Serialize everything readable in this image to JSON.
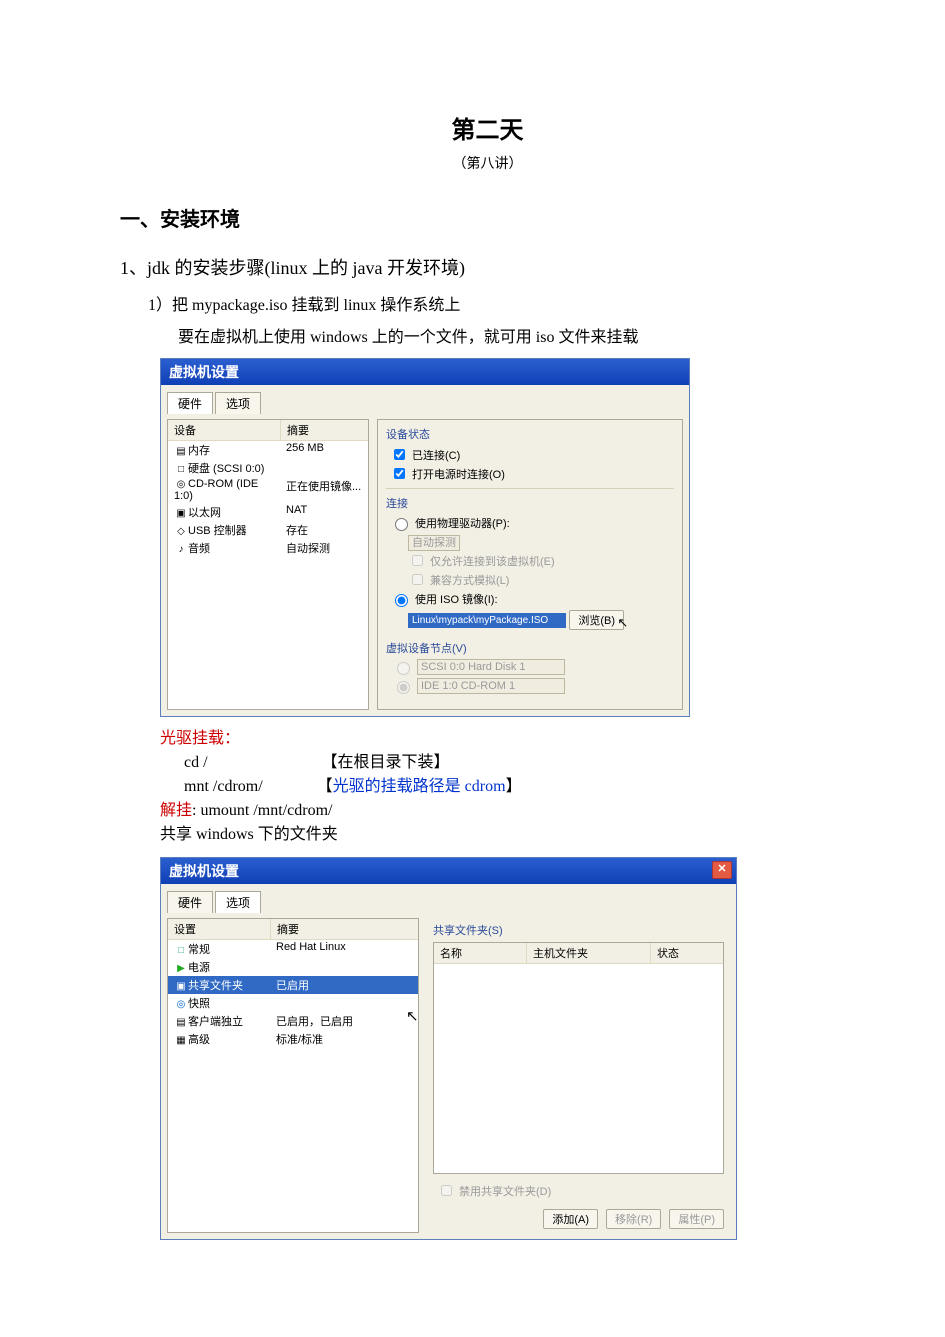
{
  "doc": {
    "title": "第二天",
    "subtitle": "（第八讲）",
    "h1": "一、安装环境",
    "h2": "1、jdk 的安装步骤(linux 上的 java  开发环境)",
    "step1_line1": "1）把 mypackage.iso  挂载到 linux 操作系统上",
    "step1_line2": "要在虚拟机上使用 windows 上的一个文件，就可用 iso 文件来挂载"
  },
  "vm1": {
    "title": "虚拟机设置",
    "tab_hardware": "硬件",
    "tab_options": "选项",
    "col_device": "设备",
    "col_summary": "摘要",
    "rows": [
      {
        "icon": "▤",
        "name": "内存",
        "summary": "256 MB"
      },
      {
        "icon": "□",
        "name": "硬盘 (SCSI 0:0)",
        "summary": ""
      },
      {
        "icon": "◎",
        "name": "CD-ROM (IDE 1:0)",
        "summary": "正在使用镜像..."
      },
      {
        "icon": "▣",
        "name": "以太网",
        "summary": "NAT"
      },
      {
        "icon": "◇",
        "name": "USB 控制器",
        "summary": "存在"
      },
      {
        "icon": "♪",
        "name": "音频",
        "summary": "自动探测"
      }
    ],
    "grp_status": "设备状态",
    "chk_connected": "已连接(C)",
    "chk_poweron": "打开电源时连接(O)",
    "grp_conn": "连接",
    "radio_phys": "使用物理驱动器(P):",
    "dd_auto": "自动探测",
    "chk_passthrough": "仅允许连接到该虚拟机(E)",
    "chk_legacy": "兼容方式模拟(L)",
    "radio_iso": "使用 ISO 镜像(I):",
    "iso_path": "Linux\\mypack\\myPackage.ISO",
    "btn_browse": "浏览(B)",
    "grp_node": "虚拟设备节点(V)",
    "dd_scsi": "SCSI 0:0   Hard Disk 1",
    "dd_ide": "IDE 1:0   CD-ROM 1"
  },
  "cmd": {
    "mount_label": "光驱挂载：",
    "cd_cmd": "cd    /",
    "cd_note": "【在根目录下装】",
    "mnt_cmd": "mnt    /cdrom/",
    "mnt_note_open": "【",
    "mnt_note_blue": "光驱的挂载路径是 cdrom",
    "mnt_note_close": "】",
    "umount_label": "解挂",
    "umount_cmd": ": umount    /mnt/cdrom/",
    "share_line": "共享 windows 下的文件夹"
  },
  "vm2": {
    "title": "虚拟机设置",
    "tab_hardware": "硬件",
    "tab_options": "选项",
    "col_setting": "设置",
    "col_summary": "摘要",
    "rows": [
      {
        "icon": "□",
        "name": "常规",
        "summary": "Red Hat Linux"
      },
      {
        "icon": "▶",
        "name": "电源",
        "summary": ""
      },
      {
        "icon": "▣",
        "name": "共享文件夹",
        "summary": "已启用",
        "selected": true
      },
      {
        "icon": "◎",
        "name": "快照",
        "summary": ""
      },
      {
        "icon": "▤",
        "name": "客户端独立",
        "summary": "已启用，已启用"
      },
      {
        "icon": "▦",
        "name": "高级",
        "summary": "标准/标准"
      }
    ],
    "grp_folders": "共享文件夹(S)",
    "col_name": "名称",
    "col_host": "主机文件夹",
    "col_state": "状态",
    "chk_disable": "禁用共享文件夹(D)",
    "btn_add": "添加(A)",
    "btn_remove": "移除(R)",
    "btn_prop": "属性(P)"
  }
}
